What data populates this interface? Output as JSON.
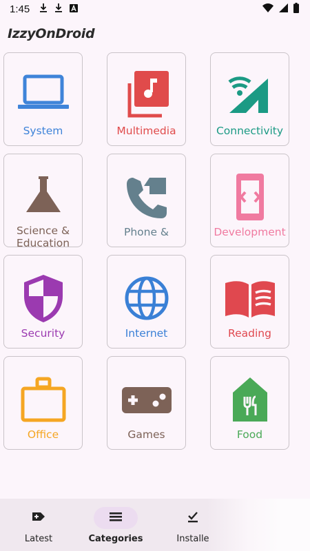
{
  "status_bar": {
    "time": "1:45"
  },
  "app": {
    "title": "IzzyOnDroid"
  },
  "categories": [
    {
      "label": "System",
      "icon": "laptop-icon",
      "color": "#3f84d9"
    },
    {
      "label": "Multimedia",
      "icon": "music-library-icon",
      "color": "#e04b4b"
    },
    {
      "label": "Connectivity",
      "icon": "wifi-signal-icon",
      "color": "#1b9a84"
    },
    {
      "label": "Science & Education",
      "icon": "flask-icon",
      "color": "#7d6257"
    },
    {
      "label": "Phone &",
      "icon": "phone-forward-icon",
      "color": "#64808d"
    },
    {
      "label": "Development",
      "icon": "developer-mode-icon",
      "color": "#f07aa0"
    },
    {
      "label": "Security",
      "icon": "shield-icon",
      "color": "#9b3ab0"
    },
    {
      "label": "Internet",
      "icon": "globe-icon",
      "color": "#3a80d6"
    },
    {
      "label": "Reading",
      "icon": "open-book-icon",
      "color": "#e0484f"
    },
    {
      "label": "Office",
      "icon": "briefcase-icon",
      "color": "#f5a623"
    },
    {
      "label": "Games",
      "icon": "gamepad-icon",
      "color": "#7d6257"
    },
    {
      "label": "Food",
      "icon": "restaurant-house-icon",
      "color": "#4aa957"
    }
  ],
  "bottom_nav": [
    {
      "label": "Latest",
      "icon": "new-label-icon",
      "active": false
    },
    {
      "label": "Categories",
      "icon": "categories-list-icon",
      "active": true
    },
    {
      "label": "Installe",
      "icon": "installed-check-icon",
      "active": false
    }
  ]
}
